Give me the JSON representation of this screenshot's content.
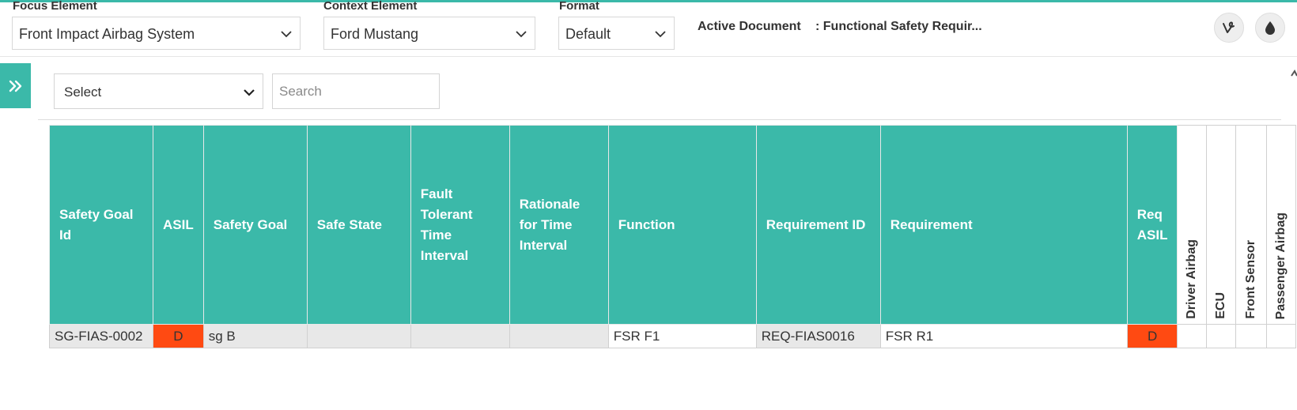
{
  "header": {
    "focus_label": "Focus Element",
    "focus_value": "Front Impact Airbag System",
    "context_label": "Context Element",
    "context_value": "Ford Mustang",
    "format_label": "Format",
    "format_value": "Default",
    "active_doc_label": "Active Document",
    "active_doc_value": ": Functional Safety Requir..."
  },
  "toolbar": {
    "select_value": "Select",
    "search_placeholder": "Search"
  },
  "table": {
    "columns": [
      "Safety Goal Id",
      "ASIL",
      "Safety Goal",
      "Safe State",
      "Fault Tolerant Time Interval",
      "Rationale for Time Interval",
      "Function",
      "Requirement ID",
      "Requirement",
      "Req ASIL",
      "Driver Airbag",
      "ECU",
      "Front Sensor",
      "Passenger Airbag"
    ],
    "rows": [
      {
        "safety_goal_id": "SG-FIAS-0002",
        "asil": "D",
        "safety_goal": "sg B",
        "safe_state": "",
        "ftti": "",
        "rationale": "",
        "function": "FSR F1",
        "requirement_id": "REQ-FIAS0016",
        "requirement": "FSR R1",
        "req_asil": "D"
      }
    ]
  },
  "colors": {
    "accent": "#3bb9a9",
    "asil_d": "#ff4a12",
    "function_text": "#2e7d32",
    "requirement_text": "#a8753e"
  },
  "icons": [
    "chevron-down-icon",
    "vine-icon",
    "water-drop-icon",
    "double-chevron-right-icon"
  ]
}
